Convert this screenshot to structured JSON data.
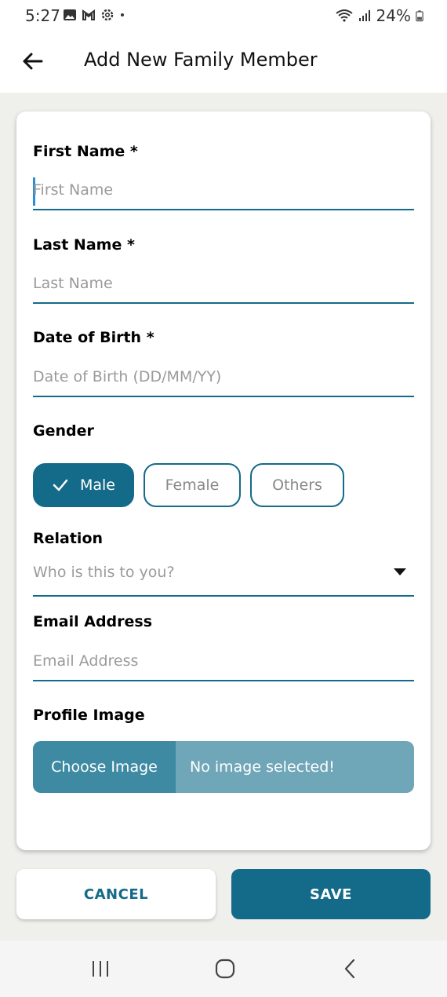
{
  "status_bar": {
    "time": "5:27",
    "battery": "24%",
    "icons": [
      "gallery-icon",
      "gmail-icon",
      "settings-icon",
      "dot-icon",
      "wifi-icon",
      "signal-icon",
      "battery-icon"
    ]
  },
  "app_bar": {
    "title": "Add New Family Member"
  },
  "form": {
    "first_name": {
      "label": "First Name *",
      "placeholder": "First Name"
    },
    "last_name": {
      "label": "Last Name *",
      "placeholder": "Last Name"
    },
    "dob": {
      "label": "Date of Birth *",
      "placeholder": "Date of Birth (DD/MM/YY)"
    },
    "gender": {
      "label": "Gender",
      "options": [
        "Male",
        "Female",
        "Others"
      ],
      "selected": "Male"
    },
    "relation": {
      "label": "Relation",
      "placeholder": "Who is this to you?"
    },
    "email": {
      "label": "Email Address",
      "placeholder": "Email Address"
    },
    "profile_image": {
      "label": "Profile Image",
      "button": "Choose Image",
      "status": "No image selected!"
    }
  },
  "actions": {
    "cancel": "CANCEL",
    "save": "SAVE"
  },
  "colors": {
    "accent": "#146a89",
    "upload_button": "#3e8aa3",
    "upload_status": "#6fa6b8",
    "background": "#efefeb"
  }
}
